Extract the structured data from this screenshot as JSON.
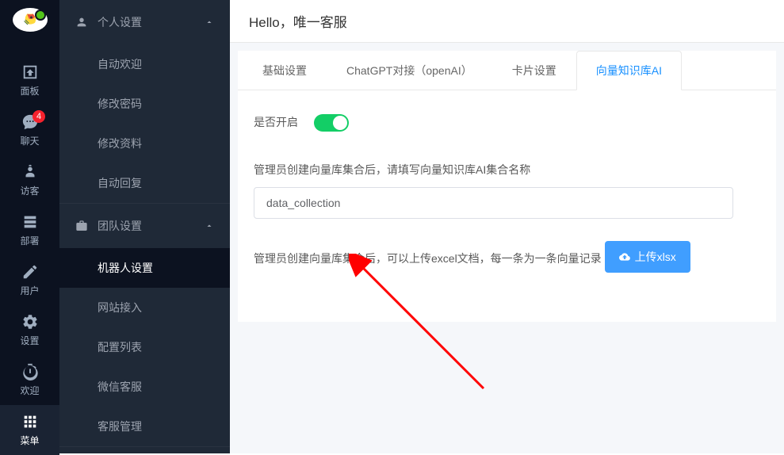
{
  "nav": {
    "items": [
      {
        "label": "面板"
      },
      {
        "label": "聊天",
        "badge": "4"
      },
      {
        "label": "访客"
      },
      {
        "label": "部署"
      },
      {
        "label": "用户"
      },
      {
        "label": "设置"
      },
      {
        "label": "欢迎"
      },
      {
        "label": "菜单"
      }
    ]
  },
  "sidebar": {
    "section1": {
      "title": "个人设置",
      "items": [
        "自动欢迎",
        "修改密码",
        "修改资料",
        "自动回复"
      ]
    },
    "section2": {
      "title": "团队设置",
      "items": [
        "机器人设置",
        "网站接入",
        "配置列表",
        "微信客服",
        "客服管理"
      ]
    }
  },
  "header": {
    "title": "Hello，唯一客服"
  },
  "tabs": [
    "基础设置",
    "ChatGPT对接（openAI）",
    "卡片设置",
    "向量知识库AI"
  ],
  "content": {
    "enable_label": "是否开启",
    "collection_label": "管理员创建向量库集合后，请填写向量知识库AI集合名称",
    "collection_value": "data_collection",
    "upload_label": "管理员创建向量库集合后，可以上传excel文档，每一条为一条向量记录",
    "upload_btn": "上传xlsx"
  }
}
